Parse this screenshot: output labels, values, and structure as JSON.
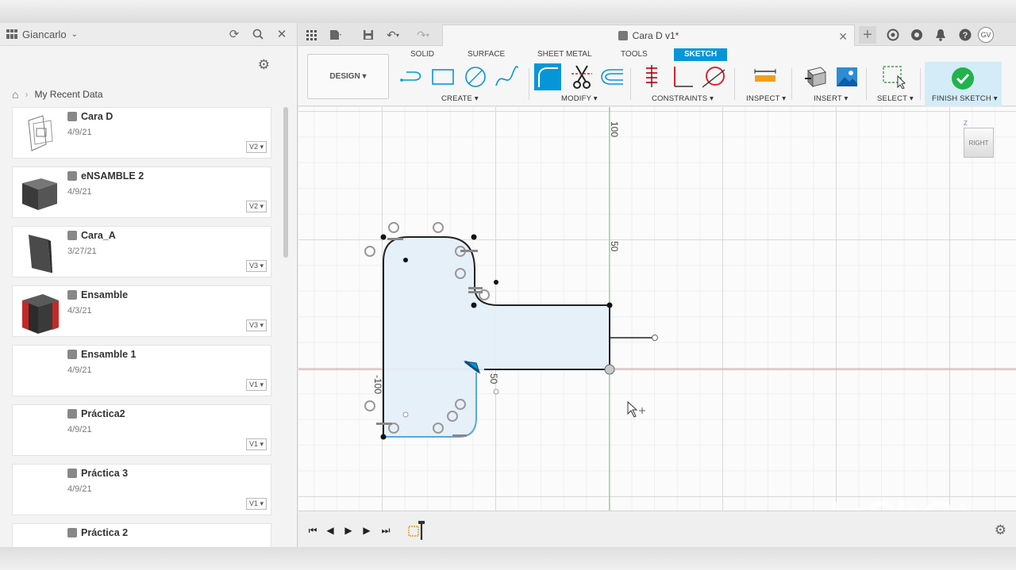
{
  "data_panel": {
    "team_name": "Giancarlo",
    "breadcrumb": "My Recent Data",
    "items": [
      {
        "name": "Cara D",
        "date": "4/9/21",
        "version": "V2 ▾",
        "thumb": "wire"
      },
      {
        "name": "eNSAMBLE 2",
        "date": "4/9/21",
        "version": "V2 ▾",
        "thumb": "dark-box"
      },
      {
        "name": "Cara_A",
        "date": "3/27/21",
        "version": "V3 ▾",
        "thumb": "plate"
      },
      {
        "name": "Ensamble",
        "date": "4/3/21",
        "version": "V3 ▾",
        "thumb": "red-box"
      },
      {
        "name": "Ensamble 1",
        "date": "4/9/21",
        "version": "V1 ▾",
        "thumb": "none"
      },
      {
        "name": "Práctica2",
        "date": "4/9/21",
        "version": "V1 ▾",
        "thumb": "none"
      },
      {
        "name": "Práctica 3",
        "date": "4/9/21",
        "version": "V1 ▾",
        "thumb": "none"
      },
      {
        "name": "Práctica 2",
        "date": "",
        "version": "",
        "thumb": "none"
      }
    ]
  },
  "document": {
    "tab_title": "Cara D v1*",
    "user_initials": "GV"
  },
  "toolbar": {
    "workspace_label": "DESIGN ▾",
    "tabs": [
      "SOLID",
      "SURFACE",
      "SHEET METAL",
      "TOOLS",
      "SKETCH"
    ],
    "groups": [
      "CREATE ▾",
      "MODIFY ▾",
      "CONSTRAINTS ▾",
      "INSPECT ▾",
      "INSERT ▾",
      "SELECT ▾",
      "FINISH SKETCH ▾"
    ]
  },
  "canvas": {
    "viewcube_label": "RIGHT",
    "axis_labels": [
      "100",
      "50",
      "-100",
      "50"
    ],
    "watermark": "InShOt"
  },
  "colors": {
    "accent": "#0696d7",
    "sketch_fill": "#e3eef8",
    "finish_green": "#22b24c"
  }
}
